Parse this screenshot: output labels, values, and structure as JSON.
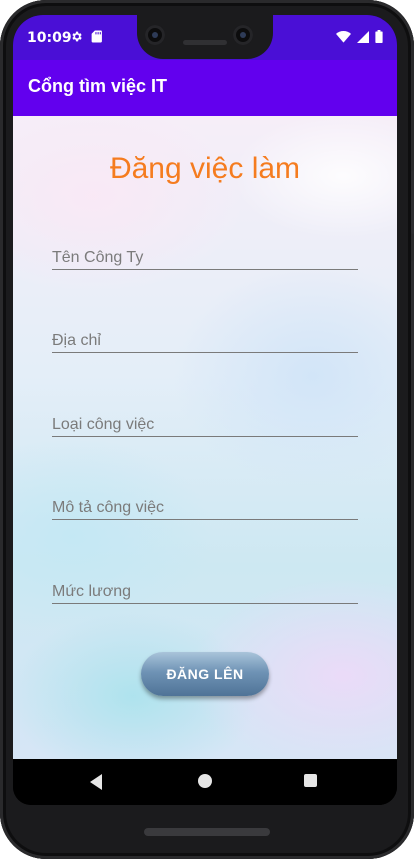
{
  "status_bar": {
    "time": "10:09",
    "left_icons": [
      "gear-icon",
      "sd-card-icon"
    ],
    "right_icons": [
      "wifi-icon",
      "signal-icon",
      "battery-icon"
    ]
  },
  "app_bar": {
    "title": "Cổng tìm việc IT"
  },
  "form": {
    "heading": "Đăng việc làm",
    "fields": [
      {
        "name": "company-name",
        "placeholder": "Tên Công Ty",
        "value": ""
      },
      {
        "name": "address",
        "placeholder": "Địa chỉ",
        "value": ""
      },
      {
        "name": "job-type",
        "placeholder": "Loại công việc",
        "value": ""
      },
      {
        "name": "job-description",
        "placeholder": "Mô tả công việc",
        "value": ""
      },
      {
        "name": "salary",
        "placeholder": "Mức lương",
        "value": ""
      }
    ],
    "submit_label": "ĐĂNG LÊN"
  },
  "colors": {
    "status_bar": "#4a0fd6",
    "app_bar": "#6200ee",
    "heading": "#f57c1f",
    "button": "#6f93b5"
  },
  "nav_bar": {
    "buttons": [
      "back-icon",
      "home-icon",
      "recent-apps-icon"
    ]
  }
}
